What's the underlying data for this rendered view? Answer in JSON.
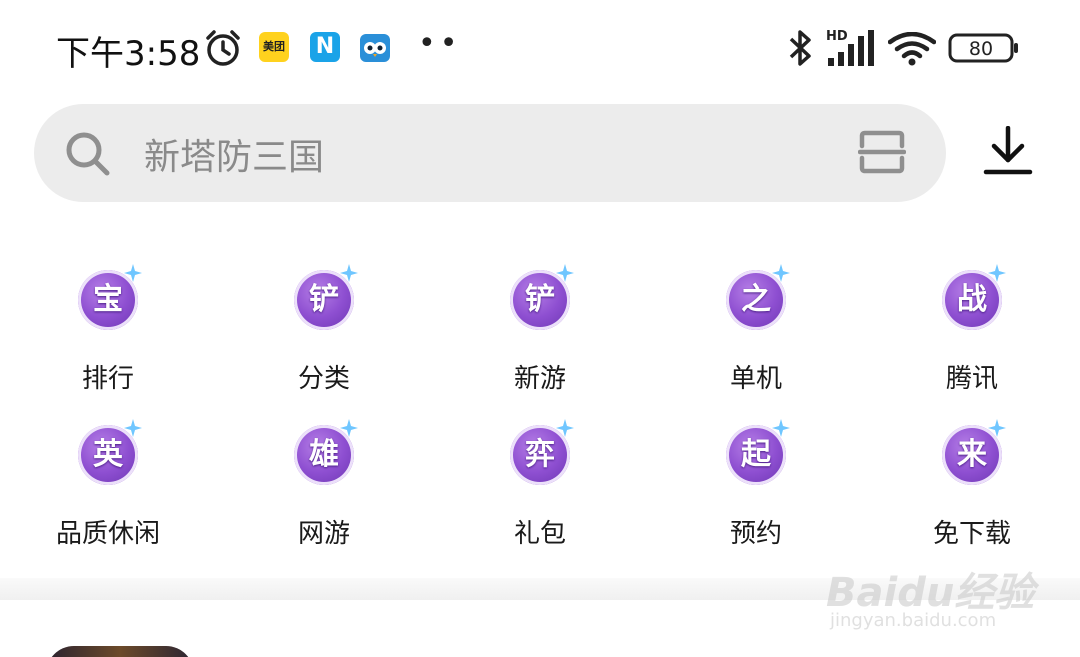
{
  "status_bar": {
    "time": "下午3:58",
    "meituan_label": "美团",
    "n_label": "N",
    "dots": "••",
    "network_label": "HD",
    "battery": "80"
  },
  "search": {
    "placeholder": "新塔防三国"
  },
  "categories": [
    {
      "label": "排行",
      "glyph": "宝"
    },
    {
      "label": "分类",
      "glyph": "铲"
    },
    {
      "label": "新游",
      "glyph": "铲"
    },
    {
      "label": "单机",
      "glyph": "之"
    },
    {
      "label": "腾讯",
      "glyph": "战"
    },
    {
      "label": "品质休闲",
      "glyph": "英"
    },
    {
      "label": "网游",
      "glyph": "雄"
    },
    {
      "label": "礼包",
      "glyph": "弈"
    },
    {
      "label": "预约",
      "glyph": "起"
    },
    {
      "label": "免下载",
      "glyph": "来"
    }
  ],
  "watermark": {
    "logo": "Baidu经验",
    "url": "jingyan.baidu.com"
  },
  "colors": {
    "badge_purple": "#8e4fd1",
    "search_bg": "#ececec"
  }
}
